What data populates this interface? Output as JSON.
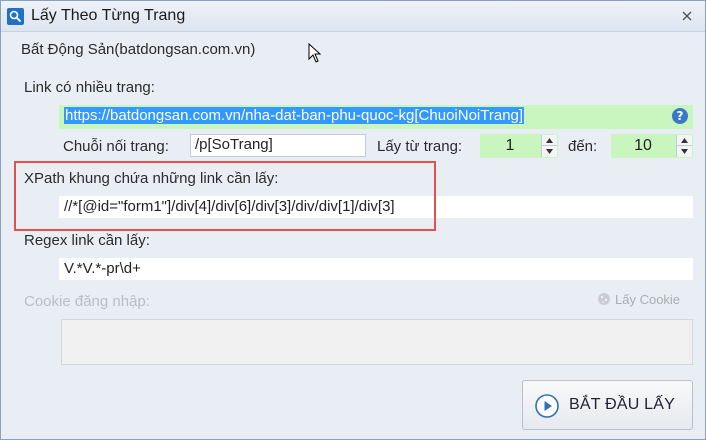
{
  "window": {
    "title": "Lấy Theo Từng Trang"
  },
  "site_name": "Bất Động Sản(batdongsan.com.vn)",
  "link": {
    "label": "Link có nhiều trang:",
    "value": "https://batdongsan.com.vn/nha-dat-ban-phu-quoc-kg[ChuoiNoiTrang]",
    "help": "?"
  },
  "page_string": {
    "label": "Chuỗi nối trang:",
    "value": "/p[SoTrang]"
  },
  "page_from": {
    "label": "Lấy từ trang:",
    "value": "1"
  },
  "page_to": {
    "label": "đến:",
    "value": "10"
  },
  "xpath": {
    "label": "XPath khung chứa những link cần lấy:",
    "value": "//*[@id=\"form1\"]/div[4]/div[6]/div[3]/div/div[1]/div[3]"
  },
  "regex": {
    "label": "Regex link cần lấy:",
    "value": "V.*V.*-pr\\d+"
  },
  "cookie": {
    "label": "Cookie đăng nhập:",
    "button_label": "Lấy Cookie",
    "value": ""
  },
  "start_button": {
    "label": "BẮT ĐẦU LẤY"
  },
  "colors": {
    "highlight_border": "#e0524e",
    "field_green": "#c9f5bf",
    "selection": "#3399ff"
  },
  "icons": {
    "app": "app-icon",
    "close": "close-icon",
    "help": "help-icon",
    "cookie": "cookie-icon",
    "start": "play-icon"
  }
}
